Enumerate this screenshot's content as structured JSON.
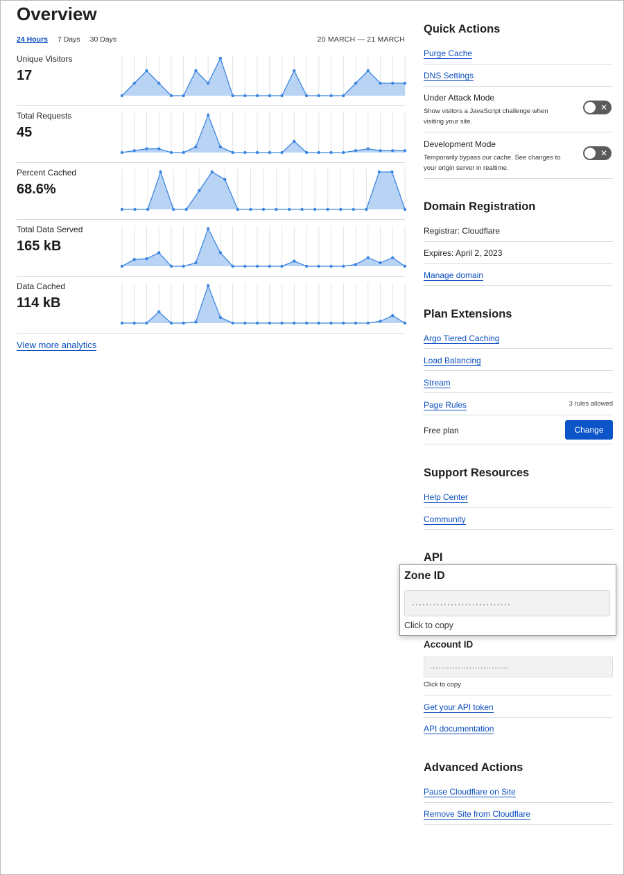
{
  "overview": {
    "title": "Overview",
    "time_tabs": [
      "24 Hours",
      "7 Days",
      "30 Days"
    ],
    "active_tab": "24 Hours",
    "date_range": "20 MARCH — 21 MARCH",
    "view_more": "View more analytics"
  },
  "metrics": [
    {
      "label": "Unique Visitors",
      "value": "17"
    },
    {
      "label": "Total Requests",
      "value": "45"
    },
    {
      "label": "Percent Cached",
      "value": "68.6%"
    },
    {
      "label": "Total Data Served",
      "value": "165 kB"
    },
    {
      "label": "Data Cached",
      "value": "114 kB"
    }
  ],
  "chart_data": [
    {
      "type": "area",
      "series": [
        {
          "values": [
            0,
            2,
            4,
            2,
            0,
            0,
            4,
            2,
            6,
            0,
            0,
            0,
            0,
            0,
            4,
            0,
            0,
            0,
            0,
            2,
            4,
            2,
            2,
            2
          ]
        }
      ],
      "ylim": [
        0,
        6
      ]
    },
    {
      "type": "area",
      "series": [
        {
          "values": [
            0,
            0.5,
            1,
            1,
            0,
            0,
            1.5,
            10,
            1.5,
            0,
            0,
            0,
            0,
            0,
            3,
            0,
            0,
            0,
            0,
            0.5,
            1,
            0.5,
            0.5,
            0.5
          ]
        }
      ],
      "ylim": [
        0,
        10
      ]
    },
    {
      "type": "area",
      "series": [
        {
          "values": [
            0,
            0,
            0,
            100,
            0,
            0,
            50,
            100,
            80,
            0,
            0,
            0,
            0,
            0,
            0,
            0,
            0,
            0,
            0,
            0,
            100,
            100,
            0
          ]
        }
      ],
      "ylim": [
        0,
        100
      ]
    },
    {
      "type": "area",
      "series": [
        {
          "values": [
            0,
            2,
            2.2,
            4,
            0,
            0,
            1,
            11,
            4,
            0,
            0,
            0,
            0,
            0,
            1.5,
            0,
            0,
            0,
            0,
            0.5,
            2.5,
            1,
            2.5,
            0
          ]
        }
      ],
      "ylim": [
        0,
        11
      ]
    },
    {
      "type": "area",
      "series": [
        {
          "values": [
            0,
            0,
            0,
            3,
            0,
            0,
            0.3,
            10,
            1.5,
            0,
            0,
            0,
            0,
            0,
            0,
            0,
            0,
            0,
            0,
            0,
            0,
            0.5,
            2,
            0
          ]
        }
      ],
      "ylim": [
        0,
        10
      ]
    }
  ],
  "chart_colors": {
    "line": "#3b86e0",
    "fill": "#b9d3f5",
    "grid": "#e3e3e3",
    "dot": "#3b86e0"
  },
  "quick_actions": {
    "title": "Quick Actions",
    "purge_cache": "Purge Cache",
    "dns_settings": "DNS Settings",
    "under_attack_title": "Under Attack Mode",
    "under_attack_desc": "Show visitors a JavaScript challenge when visiting your site.",
    "dev_mode_title": "Development Mode",
    "dev_mode_desc": "Temporarily bypass our cache. See changes to your origin server in realtime.",
    "toggle_off_glyph": "✕"
  },
  "domain_registration": {
    "title": "Domain Registration",
    "registrar": "Registrar: Cloudflare",
    "expires": "Expires: April 2, 2023",
    "manage": "Manage domain"
  },
  "plan_extensions": {
    "title": "Plan Extensions",
    "argo": "Argo Tiered Caching",
    "load_balancing": "Load Balancing",
    "stream": "Stream",
    "page_rules": "Page Rules",
    "page_rules_note": "3 rules allowed",
    "plan": "Free plan",
    "change": "Change"
  },
  "support": {
    "title": "Support Resources",
    "help": "Help Center",
    "community": "Community"
  },
  "api": {
    "title": "API",
    "zone_id_label": "Zone ID",
    "zone_id_value": "............................",
    "zone_copy": "Click to copy",
    "account_id_label": "Account ID",
    "account_id_value": "............................",
    "account_copy": "Click to copy",
    "token": "Get your API token",
    "docs": "API documentation"
  },
  "advanced": {
    "title": "Advanced Actions",
    "pause": "Pause Cloudflare on Site",
    "remove": "Remove Site from Cloudflare"
  }
}
